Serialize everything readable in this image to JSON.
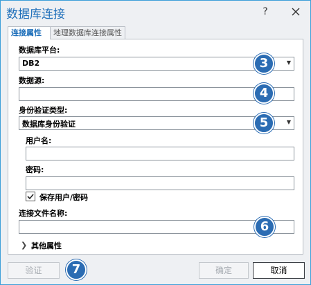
{
  "window": {
    "title": "数据库连接",
    "help": "?"
  },
  "tabs": [
    {
      "label": "连接属性",
      "active": true
    },
    {
      "label": "地理数据库连接属性",
      "active": false
    }
  ],
  "form": {
    "platform_label": "数据库平台:",
    "platform_value": "DB2",
    "datasource_label": "数据源:",
    "datasource_value": "",
    "auth_label": "身份验证类型:",
    "auth_value": "数据库身份验证",
    "user_label": "用户名:",
    "user_value": "",
    "password_label": "密码:",
    "password_value": "",
    "save_label": "保存用户/密码",
    "save_checked": true,
    "filename_label": "连接文件名称:",
    "filename_value": "",
    "more_label": "其他属性"
  },
  "callouts": [
    "3",
    "4",
    "5",
    "6",
    "7"
  ],
  "buttons": {
    "validate": "验证",
    "ok": "确定",
    "cancel": "取消"
  },
  "colors": {
    "title": "#1e6fba",
    "badge": "#2b6cb3",
    "border": "#3c9fd9"
  }
}
